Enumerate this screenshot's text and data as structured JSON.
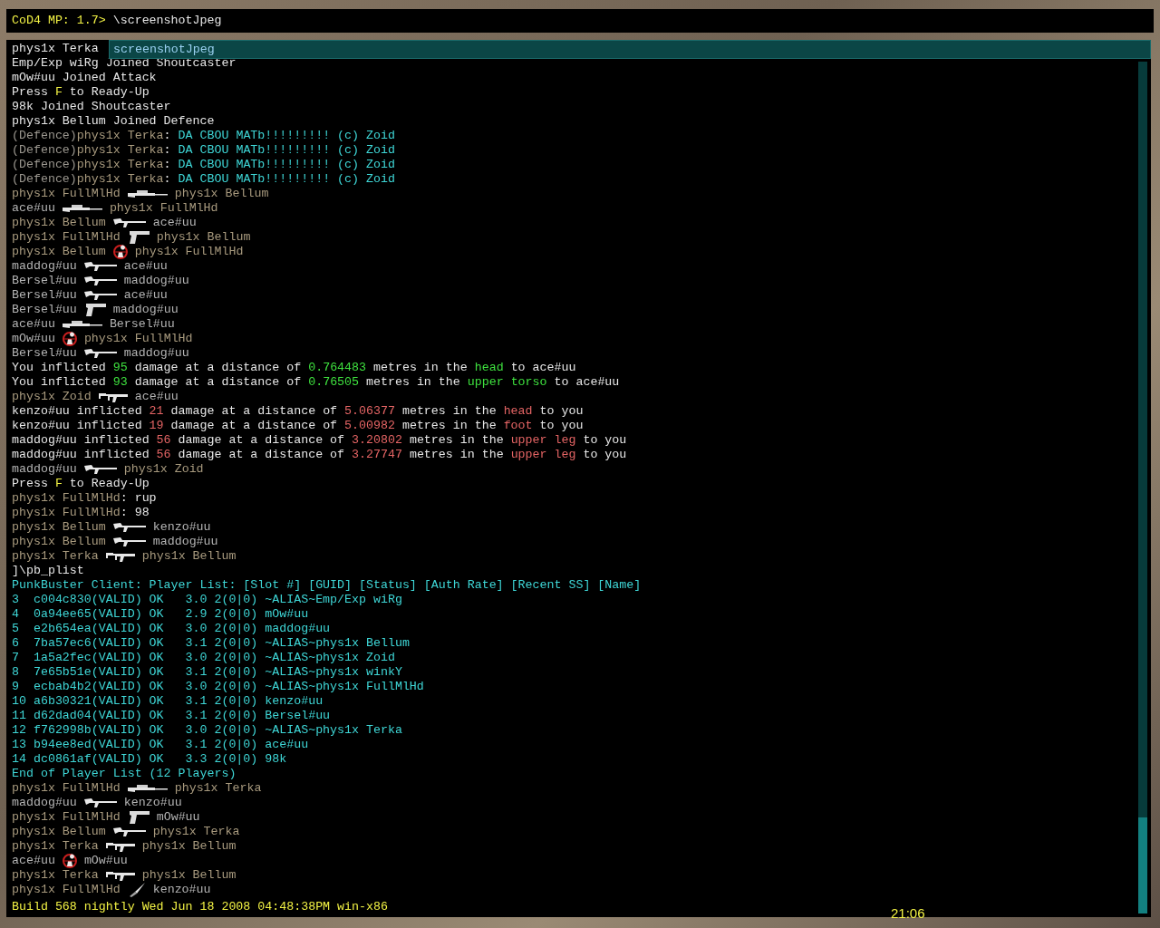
{
  "input": {
    "prompt": "CoD4 MP: 1.7>",
    "value": "\\screenshotJpeg"
  },
  "autocomplete": {
    "suggestion": "screenshotJpeg"
  },
  "console": {
    "lines": [
      {
        "kind": "text",
        "segments": [
          {
            "text": "phys1x Terka",
            "color": "#e6e6e6"
          }
        ]
      },
      {
        "kind": "text",
        "segments": [
          {
            "text": "Emp/Exp wiRg Joined Shoutcaster",
            "color": "#e6e6e6"
          }
        ]
      },
      {
        "kind": "text",
        "segments": [
          {
            "text": "mOw#uu Joined Attack",
            "color": "#e6e6e6"
          }
        ]
      },
      {
        "kind": "text",
        "segments": [
          {
            "text": "Press ",
            "color": "#e6e6e6"
          },
          {
            "text": "F",
            "color": "#f2f244"
          },
          {
            "text": " to Ready-Up",
            "color": "#e6e6e6"
          }
        ]
      },
      {
        "kind": "text",
        "segments": [
          {
            "text": "98k Joined Shoutcaster",
            "color": "#e6e6e6"
          }
        ]
      },
      {
        "kind": "text",
        "segments": [
          {
            "text": "phys1x Bellum Joined Defence",
            "color": "#e6e6e6"
          }
        ]
      },
      {
        "kind": "text",
        "segments": [
          {
            "text": "(Defence)",
            "color": "#9a968e"
          },
          {
            "text": "phys1x Terka",
            "color": "#a89a7e"
          },
          {
            "text": ": ",
            "color": "#e6e6e6"
          },
          {
            "text": "DA CBOU MATb!!!!!!!!! (c) Zoid",
            "color": "#3ed6d6"
          }
        ]
      },
      {
        "kind": "text",
        "segments": [
          {
            "text": "(Defence)",
            "color": "#9a968e"
          },
          {
            "text": "phys1x Terka",
            "color": "#a89a7e"
          },
          {
            "text": ": ",
            "color": "#e6e6e6"
          },
          {
            "text": "DA CBOU MATb!!!!!!!!! (c) Zoid",
            "color": "#3ed6d6"
          }
        ]
      },
      {
        "kind": "text",
        "segments": [
          {
            "text": "(Defence)",
            "color": "#9a968e"
          },
          {
            "text": "phys1x Terka",
            "color": "#a89a7e"
          },
          {
            "text": ": ",
            "color": "#e6e6e6"
          },
          {
            "text": "DA CBOU MATb!!!!!!!!! (c) Zoid",
            "color": "#3ed6d6"
          }
        ]
      },
      {
        "kind": "text",
        "segments": [
          {
            "text": "(Defence)",
            "color": "#9a968e"
          },
          {
            "text": "phys1x Terka",
            "color": "#a89a7e"
          },
          {
            "text": ": ",
            "color": "#e6e6e6"
          },
          {
            "text": "DA CBOU MATb!!!!!!!!! (c) Zoid",
            "color": "#3ed6d6"
          }
        ]
      },
      {
        "kind": "kill",
        "killer": {
          "text": "phys1x FullMlHd",
          "color": "#a89a7e"
        },
        "weapon": {
          "kind": "sniper"
        },
        "victim": {
          "text": "phys1x Bellum",
          "color": "#a89a7e"
        }
      },
      {
        "kind": "kill",
        "killer": {
          "text": "ace#uu",
          "color": "#b4b4b4"
        },
        "weapon": {
          "kind": "sniper"
        },
        "victim": {
          "text": "phys1x FullMlHd",
          "color": "#a89a7e"
        }
      },
      {
        "kind": "kill",
        "killer": {
          "text": "phys1x Bellum",
          "color": "#a89a7e"
        },
        "weapon": {
          "kind": "rifle"
        },
        "victim": {
          "text": "ace#uu",
          "color": "#b4b4b4"
        }
      },
      {
        "kind": "kill",
        "killer": {
          "text": "phys1x FullMlHd",
          "color": "#a89a7e"
        },
        "weapon": {
          "kind": "pistol"
        },
        "victim": {
          "text": "phys1x Bellum",
          "color": "#a89a7e"
        }
      },
      {
        "kind": "kill",
        "killer": {
          "text": "phys1x Bellum",
          "color": "#a89a7e"
        },
        "weapon": {
          "kind": "headshot"
        },
        "victim": {
          "text": "phys1x FullMlHd",
          "color": "#a89a7e"
        }
      },
      {
        "kind": "kill",
        "killer": {
          "text": "maddog#uu",
          "color": "#b4b4b4"
        },
        "weapon": {
          "kind": "rifle"
        },
        "victim": {
          "text": "ace#uu",
          "color": "#b4b4b4"
        }
      },
      {
        "kind": "kill",
        "killer": {
          "text": "Bersel#uu",
          "color": "#b4b4b4"
        },
        "weapon": {
          "kind": "rifle"
        },
        "victim": {
          "text": "maddog#uu",
          "color": "#b4b4b4"
        }
      },
      {
        "kind": "kill",
        "killer": {
          "text": "Bersel#uu",
          "color": "#b4b4b4"
        },
        "weapon": {
          "kind": "rifle"
        },
        "victim": {
          "text": "ace#uu",
          "color": "#b4b4b4"
        }
      },
      {
        "kind": "kill",
        "killer": {
          "text": "Bersel#uu",
          "color": "#b4b4b4"
        },
        "weapon": {
          "kind": "pistol"
        },
        "victim": {
          "text": "maddog#uu",
          "color": "#b4b4b4"
        }
      },
      {
        "kind": "kill",
        "killer": {
          "text": "ace#uu",
          "color": "#b4b4b4"
        },
        "weapon": {
          "kind": "sniper"
        },
        "victim": {
          "text": "Bersel#uu",
          "color": "#b4b4b4"
        }
      },
      {
        "kind": "kill",
        "killer": {
          "text": "mOw#uu",
          "color": "#b4b4b4"
        },
        "weapon": {
          "kind": "headshot"
        },
        "victim": {
          "text": "phys1x FullMlHd",
          "color": "#a89a7e"
        }
      },
      {
        "kind": "kill",
        "killer": {
          "text": "Bersel#uu",
          "color": "#b4b4b4"
        },
        "weapon": {
          "kind": "rifle"
        },
        "victim": {
          "text": "maddog#uu",
          "color": "#b4b4b4"
        }
      },
      {
        "kind": "text",
        "segments": [
          {
            "text": "You inflicted ",
            "color": "#e6e6e6"
          },
          {
            "text": "95",
            "color": "#3ee03e"
          },
          {
            "text": " damage at a distance of ",
            "color": "#e6e6e6"
          },
          {
            "text": "0.764483",
            "color": "#3ee03e"
          },
          {
            "text": " metres in the ",
            "color": "#e6e6e6"
          },
          {
            "text": "head",
            "color": "#3ee03e"
          },
          {
            "text": " to ace#uu",
            "color": "#e6e6e6"
          }
        ]
      },
      {
        "kind": "text",
        "segments": [
          {
            "text": "You inflicted ",
            "color": "#e6e6e6"
          },
          {
            "text": "93",
            "color": "#3ee03e"
          },
          {
            "text": " damage at a distance of ",
            "color": "#e6e6e6"
          },
          {
            "text": "0.76505",
            "color": "#3ee03e"
          },
          {
            "text": " metres in the ",
            "color": "#e6e6e6"
          },
          {
            "text": "upper torso",
            "color": "#3ee03e"
          },
          {
            "text": " to ace#uu",
            "color": "#e6e6e6"
          }
        ]
      },
      {
        "kind": "kill",
        "killer": {
          "text": "phys1x Zoid",
          "color": "#a89a7e"
        },
        "weapon": {
          "kind": "smg"
        },
        "victim": {
          "text": "ace#uu",
          "color": "#b4b4b4"
        }
      },
      {
        "kind": "text",
        "segments": [
          {
            "text": "kenzo#uu inflicted ",
            "color": "#e6e6e6"
          },
          {
            "text": "21",
            "color": "#e46464"
          },
          {
            "text": " damage at a distance of ",
            "color": "#e6e6e6"
          },
          {
            "text": "5.06377",
            "color": "#e46464"
          },
          {
            "text": " metres in the ",
            "color": "#e6e6e6"
          },
          {
            "text": "head",
            "color": "#e46464"
          },
          {
            "text": " to you",
            "color": "#e6e6e6"
          }
        ]
      },
      {
        "kind": "text",
        "segments": [
          {
            "text": "kenzo#uu inflicted ",
            "color": "#e6e6e6"
          },
          {
            "text": "19",
            "color": "#e46464"
          },
          {
            "text": " damage at a distance of ",
            "color": "#e6e6e6"
          },
          {
            "text": "5.00982",
            "color": "#e46464"
          },
          {
            "text": " metres in the ",
            "color": "#e6e6e6"
          },
          {
            "text": "foot",
            "color": "#e46464"
          },
          {
            "text": " to you",
            "color": "#e6e6e6"
          }
        ]
      },
      {
        "kind": "text",
        "segments": [
          {
            "text": "maddog#uu inflicted ",
            "color": "#e6e6e6"
          },
          {
            "text": "56",
            "color": "#e46464"
          },
          {
            "text": " damage at a distance of ",
            "color": "#e6e6e6"
          },
          {
            "text": "3.20802",
            "color": "#e46464"
          },
          {
            "text": " metres in the ",
            "color": "#e6e6e6"
          },
          {
            "text": "upper leg",
            "color": "#e46464"
          },
          {
            "text": " to you",
            "color": "#e6e6e6"
          }
        ]
      },
      {
        "kind": "text",
        "segments": [
          {
            "text": "maddog#uu inflicted ",
            "color": "#e6e6e6"
          },
          {
            "text": "56",
            "color": "#e46464"
          },
          {
            "text": " damage at a distance of ",
            "color": "#e6e6e6"
          },
          {
            "text": "3.27747",
            "color": "#e46464"
          },
          {
            "text": " metres in the ",
            "color": "#e6e6e6"
          },
          {
            "text": "upper leg",
            "color": "#e46464"
          },
          {
            "text": " to you",
            "color": "#e6e6e6"
          }
        ]
      },
      {
        "kind": "kill",
        "killer": {
          "text": "maddog#uu",
          "color": "#b4b4b4"
        },
        "weapon": {
          "kind": "rifle"
        },
        "victim": {
          "text": "phys1x Zoid",
          "color": "#a89a7e"
        }
      },
      {
        "kind": "text",
        "segments": [
          {
            "text": "Press ",
            "color": "#e6e6e6"
          },
          {
            "text": "F",
            "color": "#f2f244"
          },
          {
            "text": " to Ready-Up",
            "color": "#e6e6e6"
          }
        ]
      },
      {
        "kind": "text",
        "segments": [
          {
            "text": "phys1x FullMlHd",
            "color": "#a89a7e"
          },
          {
            "text": ": rup",
            "color": "#e6e6e6"
          }
        ]
      },
      {
        "kind": "text",
        "segments": [
          {
            "text": "phys1x FullMlHd",
            "color": "#a89a7e"
          },
          {
            "text": ": 98",
            "color": "#e6e6e6"
          }
        ]
      },
      {
        "kind": "kill",
        "killer": {
          "text": "phys1x Bellum",
          "color": "#a89a7e"
        },
        "weapon": {
          "kind": "rifle"
        },
        "victim": {
          "text": "kenzo#uu",
          "color": "#b4b4b4"
        }
      },
      {
        "kind": "kill",
        "killer": {
          "text": "phys1x Bellum",
          "color": "#a89a7e"
        },
        "weapon": {
          "kind": "rifle"
        },
        "victim": {
          "text": "maddog#uu",
          "color": "#b4b4b4"
        }
      },
      {
        "kind": "kill",
        "killer": {
          "text": "phys1x Terka",
          "color": "#a89a7e"
        },
        "weapon": {
          "kind": "smg"
        },
        "victim": {
          "text": "phys1x Bellum",
          "color": "#a89a7e"
        }
      },
      {
        "kind": "text",
        "segments": [
          {
            "text": "]\\pb_plist",
            "color": "#e6e6e6"
          }
        ]
      },
      {
        "kind": "text",
        "segments": [
          {
            "text": "PunkBuster Client: Player List: [Slot #] [GUID] [Status] [Auth Rate] [Recent SS] [Name]",
            "color": "#3ed6d6"
          }
        ]
      },
      {
        "kind": "text",
        "segments": [
          {
            "text": "3  c004c830(VALID) OK   3.0 2(0|0) ~ALIAS~Emp/Exp wiRg",
            "color": "#3ed6d6"
          }
        ]
      },
      {
        "kind": "text",
        "segments": [
          {
            "text": "4  0a94ee65(VALID) OK   2.9 2(0|0) mOw#uu",
            "color": "#3ed6d6"
          }
        ]
      },
      {
        "kind": "text",
        "segments": [
          {
            "text": "5  e2b654ea(VALID) OK   3.0 2(0|0) maddog#uu",
            "color": "#3ed6d6"
          }
        ]
      },
      {
        "kind": "text",
        "segments": [
          {
            "text": "6  7ba57ec6(VALID) OK   3.1 2(0|0) ~ALIAS~phys1x Bellum",
            "color": "#3ed6d6"
          }
        ]
      },
      {
        "kind": "text",
        "segments": [
          {
            "text": "7  1a5a2fec(VALID) OK   3.0 2(0|0) ~ALIAS~phys1x Zoid",
            "color": "#3ed6d6"
          }
        ]
      },
      {
        "kind": "text",
        "segments": [
          {
            "text": "8  7e65b51e(VALID) OK   3.1 2(0|0) ~ALIAS~phys1x winkY",
            "color": "#3ed6d6"
          }
        ]
      },
      {
        "kind": "text",
        "segments": [
          {
            "text": "9  ecbab4b2(VALID) OK   3.0 2(0|0) ~ALIAS~phys1x FullMlHd",
            "color": "#3ed6d6"
          }
        ]
      },
      {
        "kind": "text",
        "segments": [
          {
            "text": "10 a6b30321(VALID) OK   3.1 2(0|0) kenzo#uu",
            "color": "#3ed6d6"
          }
        ]
      },
      {
        "kind": "text",
        "segments": [
          {
            "text": "11 d62dad04(VALID) OK   3.1 2(0|0) Bersel#uu",
            "color": "#3ed6d6"
          }
        ]
      },
      {
        "kind": "text",
        "segments": [
          {
            "text": "12 f762998b(VALID) OK   3.0 2(0|0) ~ALIAS~phys1x Terka",
            "color": "#3ed6d6"
          }
        ]
      },
      {
        "kind": "text",
        "segments": [
          {
            "text": "13 b94ee8ed(VALID) OK   3.1 2(0|0) ace#uu",
            "color": "#3ed6d6"
          }
        ]
      },
      {
        "kind": "text",
        "segments": [
          {
            "text": "14 dc0861af(VALID) OK   3.3 2(0|0) 98k",
            "color": "#3ed6d6"
          }
        ]
      },
      {
        "kind": "text",
        "segments": [
          {
            "text": "End of Player List (12 Players)",
            "color": "#3ed6d6"
          }
        ]
      },
      {
        "kind": "kill",
        "killer": {
          "text": "phys1x FullMlHd",
          "color": "#a89a7e"
        },
        "weapon": {
          "kind": "sniper"
        },
        "victim": {
          "text": "phys1x Terka",
          "color": "#a89a7e"
        }
      },
      {
        "kind": "kill",
        "killer": {
          "text": "maddog#uu",
          "color": "#b4b4b4"
        },
        "weapon": {
          "kind": "rifle"
        },
        "victim": {
          "text": "kenzo#uu",
          "color": "#b4b4b4"
        }
      },
      {
        "kind": "kill",
        "killer": {
          "text": "phys1x FullMlHd",
          "color": "#a89a7e"
        },
        "weapon": {
          "kind": "pistol"
        },
        "victim": {
          "text": "mOw#uu",
          "color": "#b4b4b4"
        }
      },
      {
        "kind": "kill",
        "killer": {
          "text": "phys1x Bellum",
          "color": "#a89a7e"
        },
        "weapon": {
          "kind": "rifle"
        },
        "victim": {
          "text": "phys1x Terka",
          "color": "#a89a7e"
        }
      },
      {
        "kind": "kill",
        "killer": {
          "text": "phys1x Terka",
          "color": "#a89a7e"
        },
        "weapon": {
          "kind": "smg"
        },
        "victim": {
          "text": "phys1x Bellum",
          "color": "#a89a7e"
        }
      },
      {
        "kind": "kill",
        "killer": {
          "text": "ace#uu",
          "color": "#b4b4b4"
        },
        "weapon": {
          "kind": "headshot"
        },
        "victim": {
          "text": "mOw#uu",
          "color": "#b4b4b4"
        }
      },
      {
        "kind": "kill",
        "killer": {
          "text": "phys1x Terka",
          "color": "#a89a7e"
        },
        "weapon": {
          "kind": "smg"
        },
        "victim": {
          "text": "phys1x Bellum",
          "color": "#a89a7e"
        }
      },
      {
        "kind": "kill",
        "killer": {
          "text": "phys1x FullMlHd",
          "color": "#a89a7e"
        },
        "weapon": {
          "kind": "knife"
        },
        "victim": {
          "text": "kenzo#uu",
          "color": "#b4b4b4"
        }
      }
    ],
    "build_info": "Build 568 nightly Wed Jun 18 2008 04:48:38PM win-x86"
  },
  "hud": {
    "clock": "21:06"
  }
}
